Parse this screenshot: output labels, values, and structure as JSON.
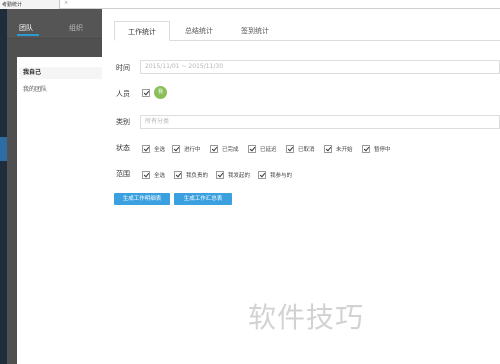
{
  "window": {
    "title": "考勤统计",
    "close_glyph": "×"
  },
  "sidebar": {
    "tabs": [
      {
        "label": "团队",
        "active": true
      },
      {
        "label": "组织",
        "active": false
      }
    ],
    "items": [
      {
        "label": "我自己",
        "selected": true
      },
      {
        "label": "我的团队",
        "selected": false
      }
    ]
  },
  "main": {
    "tabs": [
      {
        "label": "工作统计",
        "active": true
      },
      {
        "label": "总结统计"
      },
      {
        "label": "签到统计"
      }
    ],
    "filters": {
      "time": {
        "label": "时间",
        "placeholder": "2015/11/01 ~ 2015/11/30"
      },
      "person": {
        "label": "人员",
        "checked": true,
        "avatar_text": "我"
      },
      "category": {
        "label": "类别",
        "placeholder": "所有分类"
      },
      "status": {
        "label": "状态",
        "options": [
          {
            "label": "全选",
            "checked": true
          },
          {
            "label": "进行中",
            "checked": true
          },
          {
            "label": "已完成",
            "checked": true
          },
          {
            "label": "已延迟",
            "checked": true
          },
          {
            "label": "已取消",
            "checked": true
          },
          {
            "label": "未开始",
            "checked": true
          },
          {
            "label": "暂停中",
            "checked": true
          }
        ]
      },
      "scope": {
        "label": "范围",
        "options": [
          {
            "label": "全选",
            "checked": true
          },
          {
            "label": "我负责的",
            "checked": true
          },
          {
            "label": "我发起的",
            "checked": true
          },
          {
            "label": "我参与的",
            "checked": true
          }
        ]
      }
    },
    "buttons": {
      "detail": "生成工作明细表",
      "summary": "生成工作汇总表"
    }
  },
  "watermark": "软件技巧",
  "colors": {
    "accent": "#3aa0e0",
    "sidebar": "#505050",
    "avatar": "#8bbf5a"
  }
}
